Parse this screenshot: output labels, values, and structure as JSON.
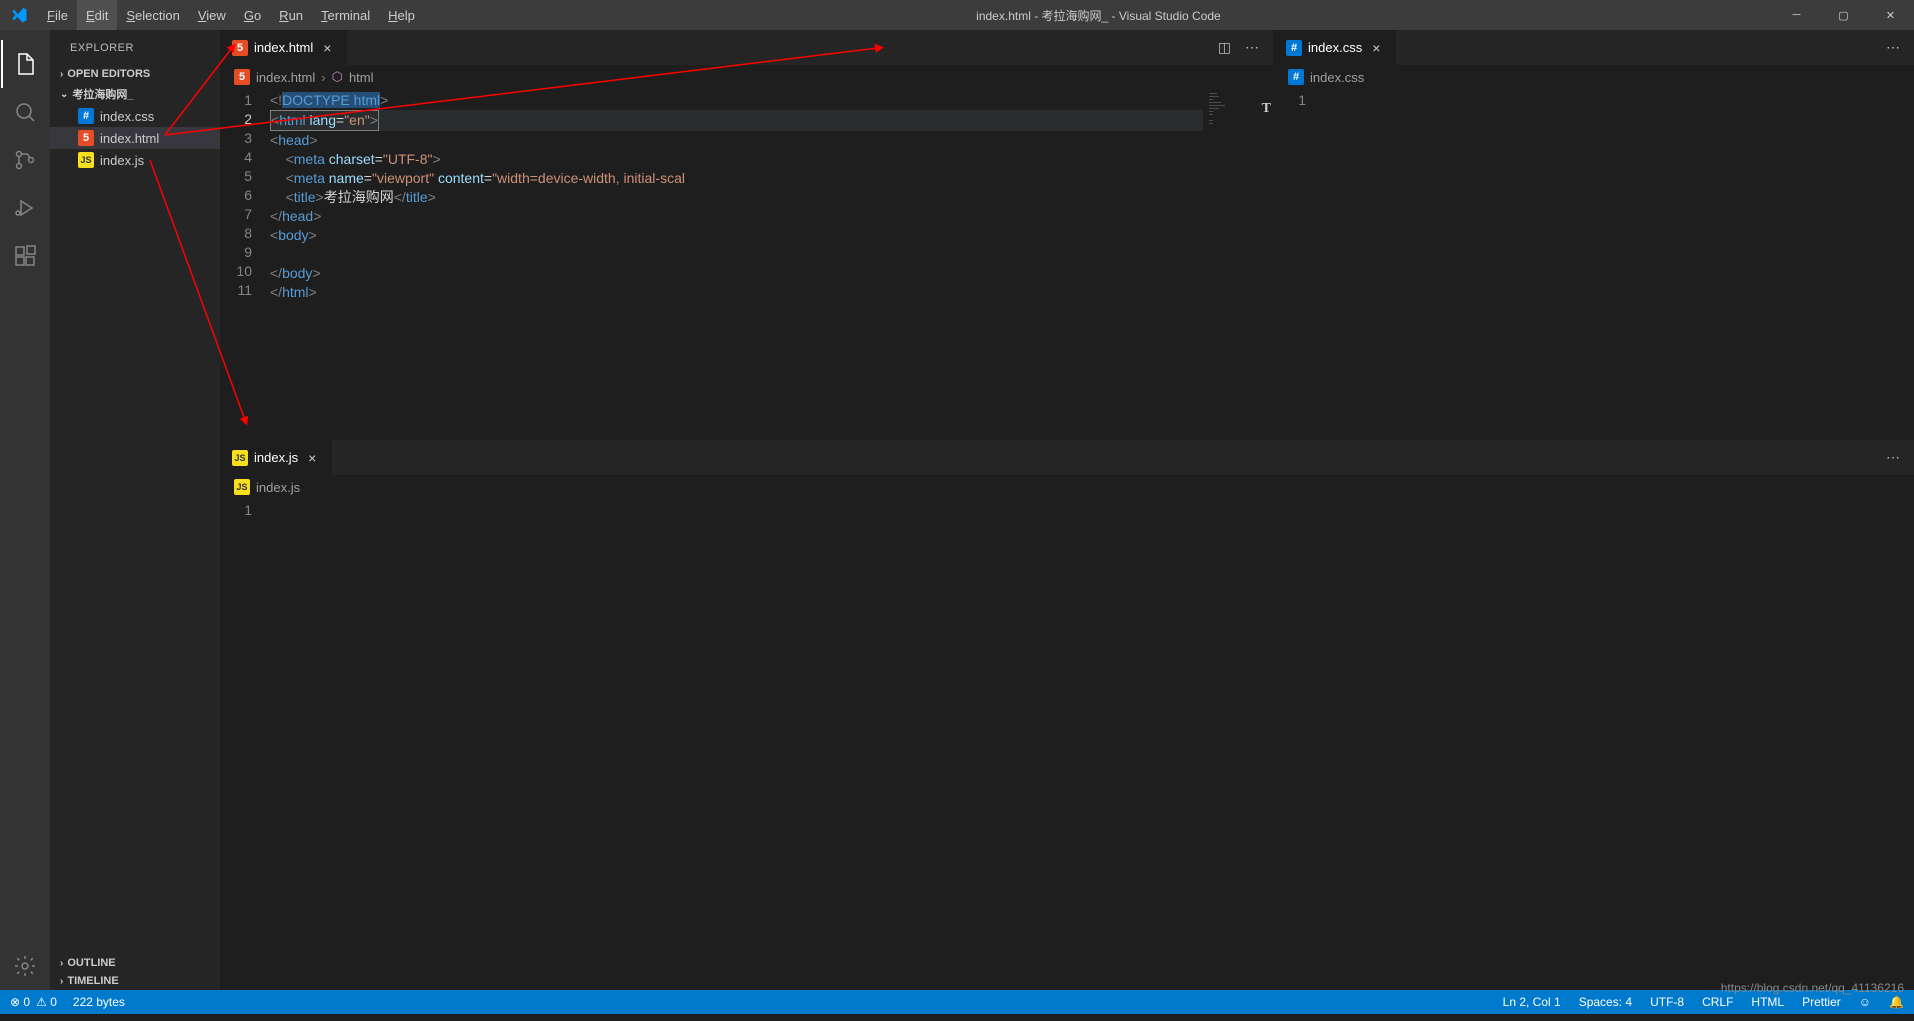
{
  "titlebar": {
    "menus": [
      {
        "label": "File",
        "u": "F"
      },
      {
        "label": "Edit",
        "u": "E"
      },
      {
        "label": "Selection",
        "u": "S"
      },
      {
        "label": "View",
        "u": "V"
      },
      {
        "label": "Go",
        "u": "G"
      },
      {
        "label": "Run",
        "u": "R"
      },
      {
        "label": "Terminal",
        "u": "T"
      },
      {
        "label": "Help",
        "u": "H"
      }
    ],
    "title": "index.html - 考拉海购网_ - Visual Studio Code"
  },
  "sidebar": {
    "header": "EXPLORER",
    "open_editors": "OPEN EDITORS",
    "project": "考拉海购网_",
    "files": [
      {
        "icon": "css",
        "name": "index.css"
      },
      {
        "icon": "html",
        "name": "index.html"
      },
      {
        "icon": "js",
        "name": "index.js"
      }
    ],
    "outline": "OUTLINE",
    "timeline": "TIMELINE"
  },
  "tabs": {
    "left": {
      "icon": "html",
      "name": "index.html"
    },
    "right": {
      "icon": "css",
      "name": "index.css"
    },
    "bottom": {
      "icon": "js",
      "name": "index.js"
    }
  },
  "breadcrumb": {
    "left": [
      {
        "icon": "html",
        "name": "index.html"
      },
      {
        "icon": "el",
        "name": "html"
      }
    ],
    "right": [
      {
        "icon": "css",
        "name": "index.css"
      }
    ],
    "bottom": [
      {
        "icon": "js",
        "name": "index.js"
      }
    ]
  },
  "code": {
    "lines": [
      "<!DOCTYPE html>",
      "<html lang=\"en\">",
      "<head>",
      "    <meta charset=\"UTF-8\">",
      "    <meta name=\"viewport\" content=\"width=device-width, initial-scal",
      "    <title>考拉海购网</title>",
      "</head>",
      "<body>",
      "",
      "</body>",
      "</html>"
    ],
    "line_numbers": [
      "1",
      "2",
      "3",
      "4",
      "5",
      "6",
      "7",
      "8",
      "9",
      "10",
      "11"
    ]
  },
  "right_line": "1",
  "bottom_line": "1",
  "status": {
    "errors_icon": "⊗",
    "errors": "0",
    "warnings_icon": "⚠",
    "warnings": "0",
    "size": "222 bytes",
    "ln_col": "Ln 2, Col 1",
    "spaces": "Spaces: 4",
    "encoding": "UTF-8",
    "eol": "CRLF",
    "lang": "HTML",
    "prettier": "Prettier",
    "feedback": "☺",
    "bell": "🔔"
  },
  "watermark": "https://blog.csdn.net/qq_41136216"
}
